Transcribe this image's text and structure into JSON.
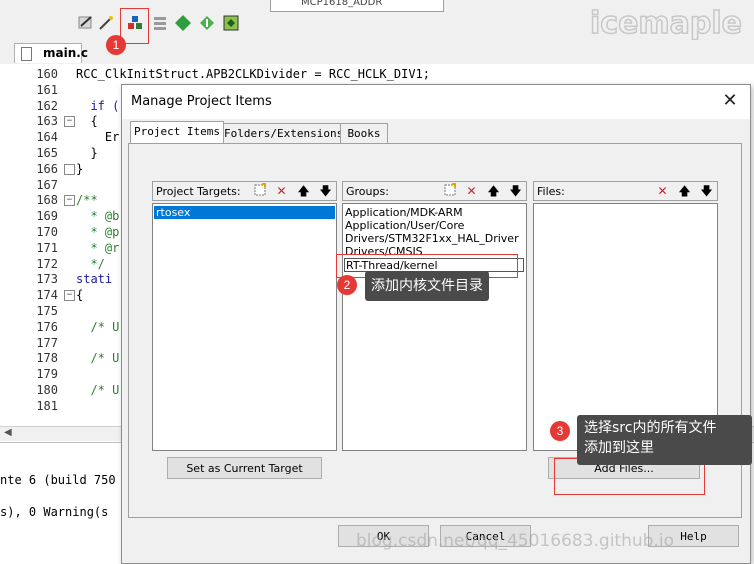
{
  "toolbar": {
    "target_text": "MCP1618_ADDR"
  },
  "editor_tab": {
    "label": "main.c"
  },
  "code_lines": [
    {
      "n": "160",
      "text": "RCC_ClkInitStruct.APB2CLKDivider = RCC_HCLK_DIV1;"
    },
    {
      "n": "161",
      "text": ""
    },
    {
      "n": "162",
      "text": "  if ("
    },
    {
      "n": "163",
      "text": "  {"
    },
    {
      "n": "164",
      "text": "    Er"
    },
    {
      "n": "165",
      "text": "  }"
    },
    {
      "n": "166",
      "text": "}"
    },
    {
      "n": "167",
      "text": ""
    },
    {
      "n": "168",
      "text": "/**"
    },
    {
      "n": "169",
      "text": "  * @b"
    },
    {
      "n": "170",
      "text": "  * @p"
    },
    {
      "n": "171",
      "text": "  * @r"
    },
    {
      "n": "172",
      "text": "  */"
    },
    {
      "n": "173",
      "text": "stati"
    },
    {
      "n": "174",
      "text": "{"
    },
    {
      "n": "175",
      "text": ""
    },
    {
      "n": "176",
      "text": "  /* U"
    },
    {
      "n": "177",
      "text": ""
    },
    {
      "n": "178",
      "text": "  /* U"
    },
    {
      "n": "179",
      "text": ""
    },
    {
      "n": "180",
      "text": "  /* U"
    },
    {
      "n": "181",
      "text": ""
    }
  ],
  "output_lines": [
    "nte 6 (build 750",
    "s), 0 Warning(s"
  ],
  "dialog": {
    "title": "Manage Project Items",
    "close_glyph": "✕",
    "tabs": [
      "Project Items",
      "Folders/Extensions",
      "Books"
    ],
    "targets_label": "Project Targets:",
    "groups_label": "Groups:",
    "files_label": "Files:",
    "targets": [
      "rtosex"
    ],
    "groups": [
      "Application/MDK-ARM",
      "Application/User/Core",
      "Drivers/STM32F1xx_HAL_Driver",
      "Drivers/CMSIS"
    ],
    "group_edit_value": "RT-Thread/kernel",
    "set_target_button": "Set as Current Target",
    "add_files_button": "Add Files...",
    "ok_button": "OK",
    "cancel_button": "Cancel",
    "help_button": "Help"
  },
  "annotations": {
    "badge1": "1",
    "badge2": "2",
    "badge3": "3",
    "callout2": "添加内核文件目录",
    "callout3_line1": "选择src内的所有文件",
    "callout3_line2": "添加到这里"
  },
  "watermark_top": "icemaple",
  "watermark_bottom": "blog.csdn.net/qq_45016683.github.io",
  "colors": {
    "accent_red": "#e53935",
    "callout_bg": "#4a4a4a",
    "selection_blue": "#0078d7"
  }
}
